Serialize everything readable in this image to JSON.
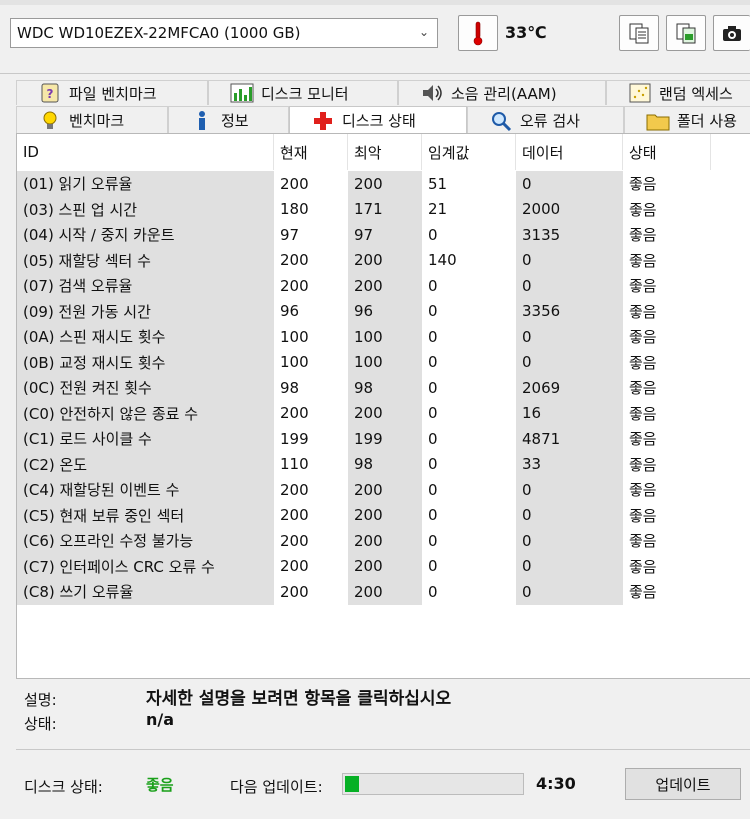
{
  "toolbar": {
    "drive": "WDC WD10EZEX-22MFCA0 (1000 GB)",
    "temperature": "33℃"
  },
  "tabs_top": [
    {
      "label": "파일 벤치마크",
      "icon": "file-benchmark-icon"
    },
    {
      "label": "디스크 모니터",
      "icon": "disk-monitor-icon"
    },
    {
      "label": "소음 관리(AAM)",
      "icon": "speaker-icon"
    },
    {
      "label": "랜덤 엑세스",
      "icon": "random-access-icon"
    }
  ],
  "tabs_bottom": [
    {
      "label": "벤치마크",
      "icon": "lightbulb-icon"
    },
    {
      "label": "정보",
      "icon": "info-icon"
    },
    {
      "label": "디스크 상태",
      "icon": "red-cross-icon"
    },
    {
      "label": "오류 검사",
      "icon": "magnifier-icon"
    },
    {
      "label": "폴더 사용",
      "icon": "folder-icon"
    }
  ],
  "table": {
    "headers": [
      "ID",
      "현재",
      "최악",
      "임계값",
      "데이터",
      "상태"
    ],
    "rows": [
      [
        "(01) 읽기 오류율",
        "200",
        "200",
        "51",
        "0",
        "좋음"
      ],
      [
        "(03) 스핀 업 시간",
        "180",
        "171",
        "21",
        "2000",
        "좋음"
      ],
      [
        "(04) 시작 / 중지 카운트",
        "97",
        "97",
        "0",
        "3135",
        "좋음"
      ],
      [
        "(05) 재할당 섹터 수",
        "200",
        "200",
        "140",
        "0",
        "좋음"
      ],
      [
        "(07) 검색 오류율",
        "200",
        "200",
        "0",
        "0",
        "좋음"
      ],
      [
        "(09) 전원 가동 시간",
        "96",
        "96",
        "0",
        "3356",
        "좋음"
      ],
      [
        "(0A) 스핀 재시도 횟수",
        "100",
        "100",
        "0",
        "0",
        "좋음"
      ],
      [
        "(0B) 교정 재시도 횟수",
        "100",
        "100",
        "0",
        "0",
        "좋음"
      ],
      [
        "(0C) 전원 켜진 횟수",
        "98",
        "98",
        "0",
        "2069",
        "좋음"
      ],
      [
        "(C0) 안전하지 않은 종료 수",
        "200",
        "200",
        "0",
        "16",
        "좋음"
      ],
      [
        "(C1) 로드 사이클 수",
        "199",
        "199",
        "0",
        "4871",
        "좋음"
      ],
      [
        "(C2) 온도",
        "110",
        "98",
        "0",
        "33",
        "좋음"
      ],
      [
        "(C4) 재할당된 이벤트 수",
        "200",
        "200",
        "0",
        "0",
        "좋음"
      ],
      [
        "(C5) 현재 보류 중인 섹터",
        "200",
        "200",
        "0",
        "0",
        "좋음"
      ],
      [
        "(C6) 오프라인 수정 불가능",
        "200",
        "200",
        "0",
        "0",
        "좋음"
      ],
      [
        "(C7) 인터페이스 CRC 오류 수",
        "200",
        "200",
        "0",
        "0",
        "좋음"
      ],
      [
        "(C8) 쓰기 오류율",
        "200",
        "200",
        "0",
        "0",
        "좋음"
      ]
    ]
  },
  "info": {
    "description_label": "설명:",
    "description_value": "자세한 설명을 보려면 항목을 클릭하십시오",
    "status_label": "상태:",
    "status_value": "n/a"
  },
  "footer": {
    "disk_status_label": "디스크 상태:",
    "disk_status_value": "좋음",
    "disk_status_color": "#1aa01a",
    "next_update_label": "다음 업데이트:",
    "progress_fraction": 0.08,
    "countdown": "4:30",
    "update_button": "업데이트"
  }
}
